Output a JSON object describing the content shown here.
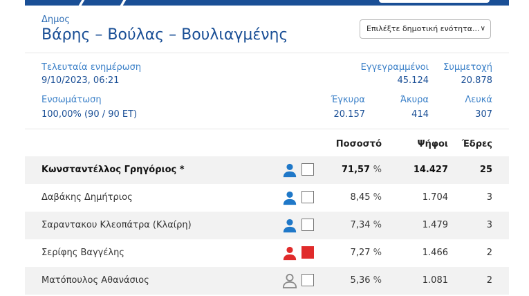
{
  "header": {
    "label": "Δημος",
    "title": "Βάρης – Βούλας – Βουλιαγμένης",
    "select_label": "Επιλέξτε δημοτική ενότητα..."
  },
  "stats": {
    "last_update_label": "Τελευταία ενημέρωση",
    "last_update_value": "9/10/2023, 06:21",
    "integration_label": "Ενσωμάτωση",
    "integration_value": "100,00% (90 / 90 ΕΤ)",
    "registered_label": "Εγγεγραμμένοι",
    "registered_value": "45.124",
    "turnout_label": "Συμμετοχή",
    "turnout_value": "20.878",
    "valid_label": "Έγκυρα",
    "valid_value": "20.157",
    "invalid_label": "Άκυρα",
    "invalid_value": "414",
    "blank_label": "Λευκά",
    "blank_value": "307"
  },
  "table": {
    "headers": {
      "percent": "Ποσοστό",
      "votes": "Ψήφοι",
      "seats": "Έδρες"
    },
    "percent_unit": "%",
    "rows": [
      {
        "name": "Κωνσταντέλλος Γρηγόριος *",
        "percent": "71,57",
        "votes": "14.427",
        "seats": "25",
        "icon_color": "#1f78c8",
        "swatch_color": "#ffffff"
      },
      {
        "name": "Δαβάκης Δημήτριος",
        "percent": "8,45",
        "votes": "1.704",
        "seats": "3",
        "icon_color": "#1f78c8",
        "swatch_color": "#ffffff"
      },
      {
        "name": "Σαραντακου Κλεοπάτρα (Κλαίρη)",
        "percent": "7,34",
        "votes": "1.479",
        "seats": "3",
        "icon_color": "#1f78c8",
        "swatch_color": "#ffffff"
      },
      {
        "name": "Σερίφης Βαγγέλης",
        "percent": "7,27",
        "votes": "1.466",
        "seats": "2",
        "icon_color": "#e02b2b",
        "swatch_color": "#e02b2b"
      },
      {
        "name": "Ματόπουλος Αθανάσιος",
        "percent": "5,36",
        "votes": "1.081",
        "seats": "2",
        "icon_color": "#8a8a8a",
        "swatch_color": "#ffffff",
        "icon_outline": true
      }
    ]
  },
  "colors": {
    "brand": "#1a4f96",
    "accent_text": "#3b80c8",
    "alt_row": "#f2f2f2"
  }
}
